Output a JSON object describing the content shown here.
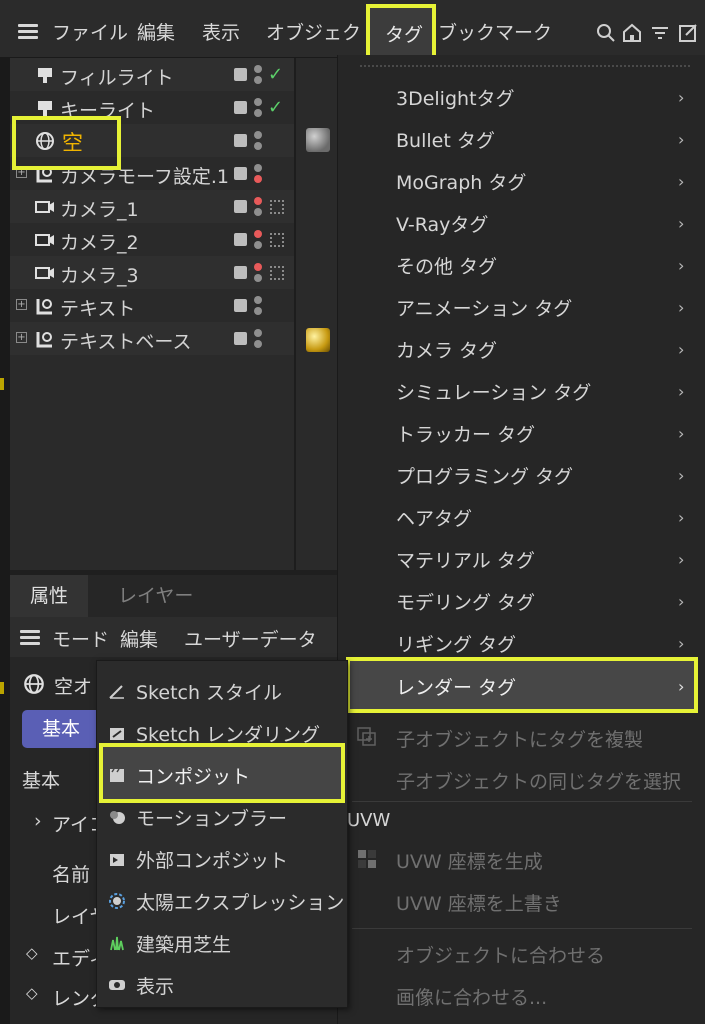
{
  "menubar": {
    "items": [
      "ファイル",
      "編集",
      "表示",
      "オブジェクト",
      "タグ",
      "ブックマーク"
    ],
    "icons": [
      "search-icon",
      "home-icon",
      "filter-icon",
      "external-icon"
    ]
  },
  "objects": [
    {
      "name": "フィルライト",
      "checked": true
    },
    {
      "name": "キーライト",
      "checked": true
    },
    {
      "name": "空",
      "selected": true,
      "material": "grey"
    },
    {
      "name": "カメラモーフ設定.1",
      "expand": true
    },
    {
      "name": "カメラ_1"
    },
    {
      "name": "カメラ_2"
    },
    {
      "name": "カメラ_3"
    },
    {
      "name": "テキスト",
      "expand": true
    },
    {
      "name": "テキストベース",
      "expand": true,
      "material": "gold"
    }
  ],
  "attributes": {
    "tabs": [
      "属性",
      "レイヤー"
    ],
    "menu": [
      "モード",
      "編集",
      "ユーザーデータ"
    ],
    "object_label": "空オ",
    "basic_button": "基本",
    "section_title": "基本",
    "rows": [
      "アイコ",
      "名前",
      "レイヤ",
      "エディ",
      "レンダ"
    ]
  },
  "tag_menu": {
    "items": [
      "3Delightタグ",
      "Bullet タグ",
      "MoGraph タグ",
      "V-Rayタグ",
      "その他 タグ",
      "アニメーション タグ",
      "カメラ タグ",
      "シミュレーション タグ",
      "トラッカー タグ",
      "プログラミング タグ",
      "ヘアタグ",
      "マテリアル タグ",
      "モデリング タグ",
      "リギング タグ",
      "レンダー タグ"
    ],
    "disabled_items": [
      "子オブジェクトにタグを複製",
      "子オブジェクトの同じタグを選択"
    ],
    "uvw_section": "UVW",
    "uvw_items": [
      "UVW 座標を生成",
      "UVW 座標を上書き"
    ],
    "fit_items": [
      "オブジェクトに合わせる",
      "画像に合わせる..."
    ]
  },
  "render_submenu": {
    "items": [
      "Sketch スタイル",
      "Sketch レンダリング",
      "コンポジット",
      "モーションブラー",
      "外部コンポジット",
      "太陽エクスプレッション",
      "建築用芝生",
      "表示"
    ],
    "highlighted": "コンポジット"
  },
  "colors": {
    "highlight_box": "#e6f236",
    "selected_text": "#f0b400",
    "basic_button": "#5a5fb5"
  }
}
